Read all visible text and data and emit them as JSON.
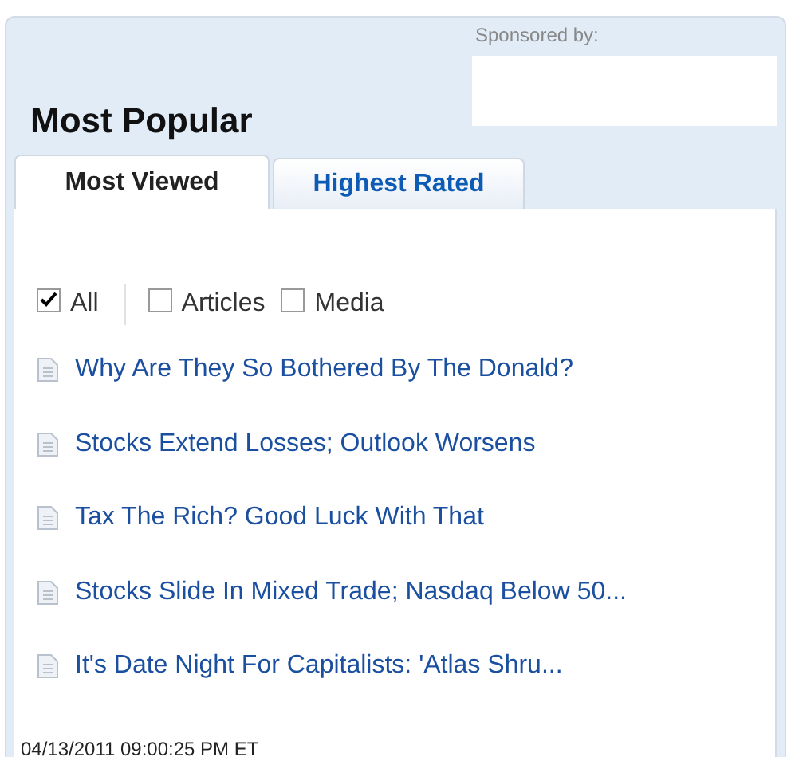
{
  "sponsor": {
    "label": "Sponsored by:"
  },
  "title": "Most Popular",
  "tabs": [
    {
      "label": "Most Viewed",
      "selected": true
    },
    {
      "label": "Highest Rated",
      "selected": false
    }
  ],
  "filters": [
    {
      "label": "All",
      "checked": true
    },
    {
      "label": "Articles",
      "checked": false
    },
    {
      "label": "Media",
      "checked": false
    }
  ],
  "stories": [
    "Why Are They So Bothered By The Donald?",
    "Stocks Extend Losses; Outlook Worsens",
    "Tax The Rich? Good Luck With That",
    "Stocks Slide In Mixed Trade; Nasdaq Below 50...",
    "It's Date Night For Capitalists: 'Atlas Shru..."
  ],
  "timestamp": "04/13/2011 09:00:25 PM ET"
}
